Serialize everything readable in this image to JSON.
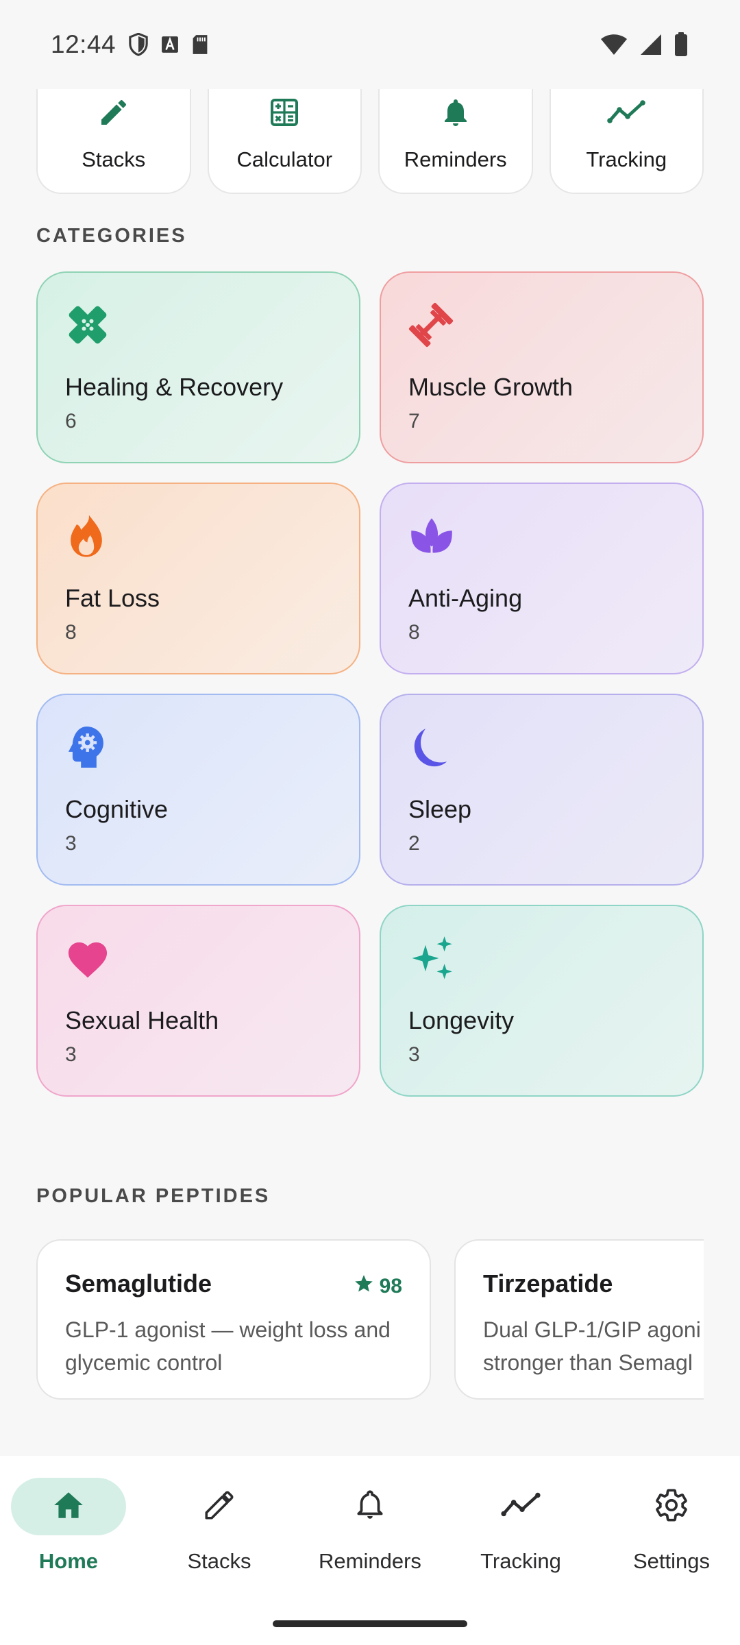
{
  "status_bar": {
    "time": "12:44",
    "left_icons": [
      "shield-icon",
      "a-box-icon",
      "sd-card-icon"
    ],
    "right_icons": [
      "wifi-icon",
      "signal-icon",
      "battery-icon"
    ]
  },
  "quick_actions": [
    {
      "label": "Stacks",
      "icon": "pencil-icon"
    },
    {
      "label": "Calculator",
      "icon": "calculator-icon"
    },
    {
      "label": "Reminders",
      "icon": "bell-icon"
    },
    {
      "label": "Tracking",
      "icon": "trend-line-icon"
    }
  ],
  "categories_title": "CATEGORIES",
  "categories": [
    {
      "name": "Healing & Recovery",
      "count": "6",
      "icon": "bandage-icon",
      "color": "#1f9e6b"
    },
    {
      "name": "Muscle Growth",
      "count": "7",
      "icon": "dumbbell-icon",
      "color": "#e0454a"
    },
    {
      "name": "Fat Loss",
      "count": "8",
      "icon": "flame-icon",
      "color": "#f06a1c"
    },
    {
      "name": "Anti-Aging",
      "count": "8",
      "icon": "lotus-icon",
      "color": "#8a55e6"
    },
    {
      "name": "Cognitive",
      "count": "3",
      "icon": "brain-gear-icon",
      "color": "#3e74ea"
    },
    {
      "name": "Sleep",
      "count": "2",
      "icon": "moon-icon",
      "color": "#5a55e6"
    },
    {
      "name": "Sexual Health",
      "count": "3",
      "icon": "heart-icon",
      "color": "#e6448e"
    },
    {
      "name": "Longevity",
      "count": "3",
      "icon": "sparkles-icon",
      "color": "#19a58e"
    }
  ],
  "popular_title": "POPULAR PEPTIDES",
  "popular": [
    {
      "name": "Semaglutide",
      "score": "98",
      "desc_line1": "GLP-1 agonist — weight loss and",
      "desc_line2": "glycemic control"
    },
    {
      "name": "Tirzepatide",
      "score": "",
      "desc_line1": "Dual GLP-1/GIP agoni",
      "desc_line2": "stronger than Semagl"
    }
  ],
  "bottom_nav": [
    {
      "label": "Home",
      "icon": "home-icon",
      "active": true
    },
    {
      "label": "Stacks",
      "icon": "pencil-icon",
      "active": false
    },
    {
      "label": "Reminders",
      "icon": "bell-icon",
      "active": false
    },
    {
      "label": "Tracking",
      "icon": "trend-line-icon",
      "active": false
    },
    {
      "label": "Settings",
      "icon": "gear-icon",
      "active": false
    }
  ],
  "colors": {
    "accent": "#1f7a58",
    "nav_active_bg": "#d6efe6",
    "background": "#f7f7f7"
  }
}
